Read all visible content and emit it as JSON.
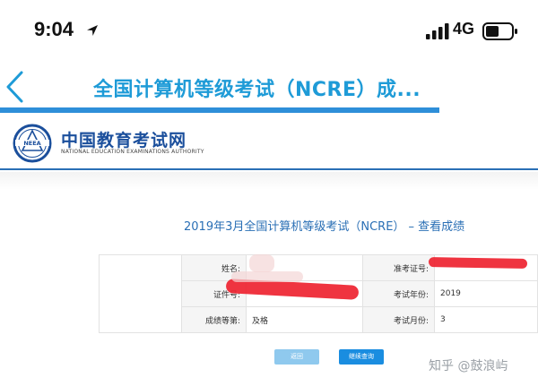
{
  "status_bar": {
    "time": "9:04",
    "network": "4G"
  },
  "nav": {
    "title": "全国计算机等级考试（NCRE）成..."
  },
  "site": {
    "name": "中国教育考试网",
    "subname": "NATIONAL EDUCATION EXAMINATIONS AUTHORITY",
    "logo_text": "NEEA"
  },
  "page": {
    "heading": "2019年3月全国计算机等级考试（NCRE） – 查看成绩"
  },
  "result": {
    "rows": [
      {
        "label1": "姓名:",
        "value1": "",
        "label2": "准考证号:",
        "value2": ""
      },
      {
        "label1": "证件号:",
        "value1": "",
        "label2": "考试年份:",
        "value2": "2019"
      },
      {
        "label1": "成绩等第:",
        "value1": "及格",
        "label2": "考试月份:",
        "value2": "3"
      }
    ]
  },
  "buttons": {
    "back": "返回",
    "continue": "继续查询"
  },
  "watermark": "知乎 @鼓浪屿",
  "colors": {
    "accent": "#1e9bd7",
    "brand": "#1b4f9c",
    "redaction": "#ee2330"
  }
}
